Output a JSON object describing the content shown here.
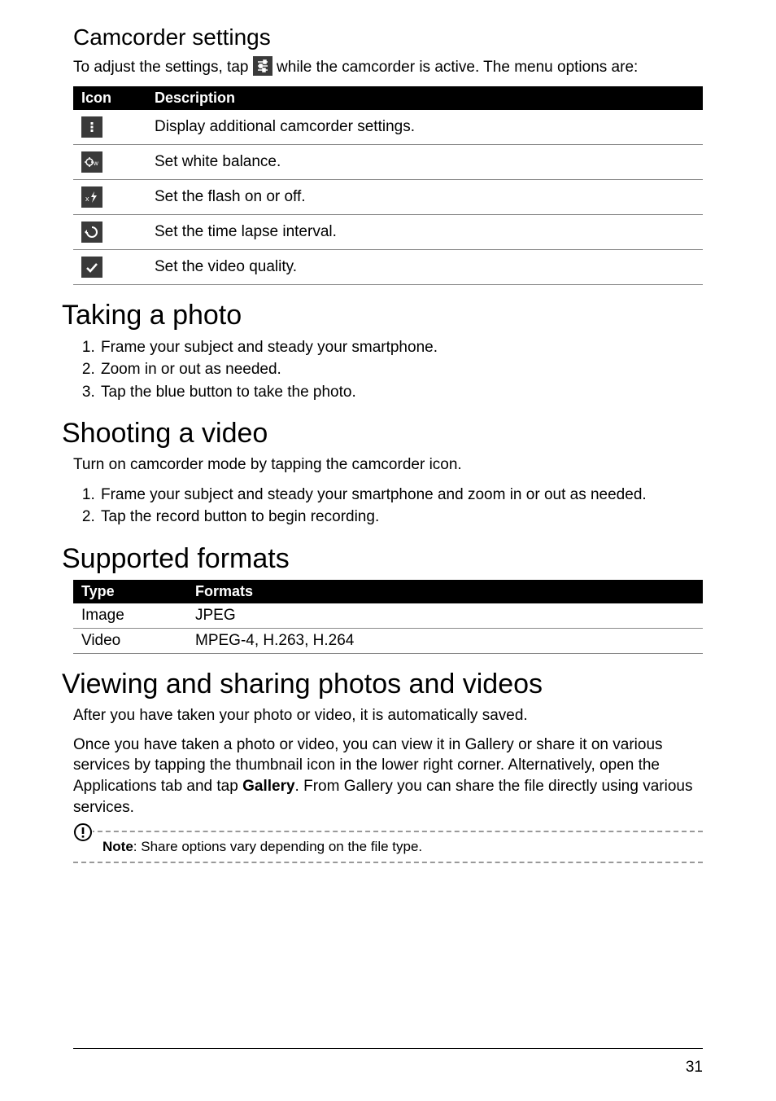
{
  "heading_camcorder": "Camcorder settings",
  "camcorder_intro_before": "To adjust the settings, tap ",
  "camcorder_intro_after": " while the camcorder is active. The menu options are:",
  "settings_table": {
    "head_icon": "Icon",
    "head_desc": "Description",
    "rows": [
      {
        "icon": "overflow-icon",
        "desc": "Display additional camcorder settings."
      },
      {
        "icon": "white-balance-icon",
        "desc": "Set white balance."
      },
      {
        "icon": "flash-off-icon",
        "desc": "Set the flash on or off."
      },
      {
        "icon": "time-lapse-icon",
        "desc": "Set the time lapse interval."
      },
      {
        "icon": "video-quality-icon",
        "desc": "Set the video quality."
      }
    ]
  },
  "heading_photo": "Taking a photo",
  "photo_steps": [
    "Frame your subject and steady your smartphone.",
    "Zoom in or out as needed.",
    "Tap the blue button to take the photo."
  ],
  "heading_video": "Shooting a video",
  "video_intro": "Turn on camcorder mode by tapping the camcorder icon.",
  "video_steps": [
    "Frame your subject and steady your smartphone and zoom in or out as needed.",
    "Tap the record button to begin recording."
  ],
  "heading_formats": "Supported formats",
  "formats_table": {
    "head_type": "Type",
    "head_formats": "Formats",
    "rows": [
      {
        "type": "Image",
        "formats": "JPEG"
      },
      {
        "type": "Video",
        "formats": "MPEG-4, H.263, H.264"
      }
    ]
  },
  "heading_viewing": "Viewing and sharing photos and videos",
  "viewing_p1": "After you have taken your photo or video, it is automatically saved.",
  "viewing_p2_a": "Once you have taken a photo or video, you can view it in Gallery or share it on various services by tapping the thumbnail icon in the lower right corner. Alternatively, open the Applications tab and tap ",
  "viewing_p2_bold": "Gallery",
  "viewing_p2_b": ". From Gallery you can share the file directly using various services.",
  "note_label": "Note",
  "note_text": ": Share options vary depending on the file type.",
  "page_number": "31"
}
